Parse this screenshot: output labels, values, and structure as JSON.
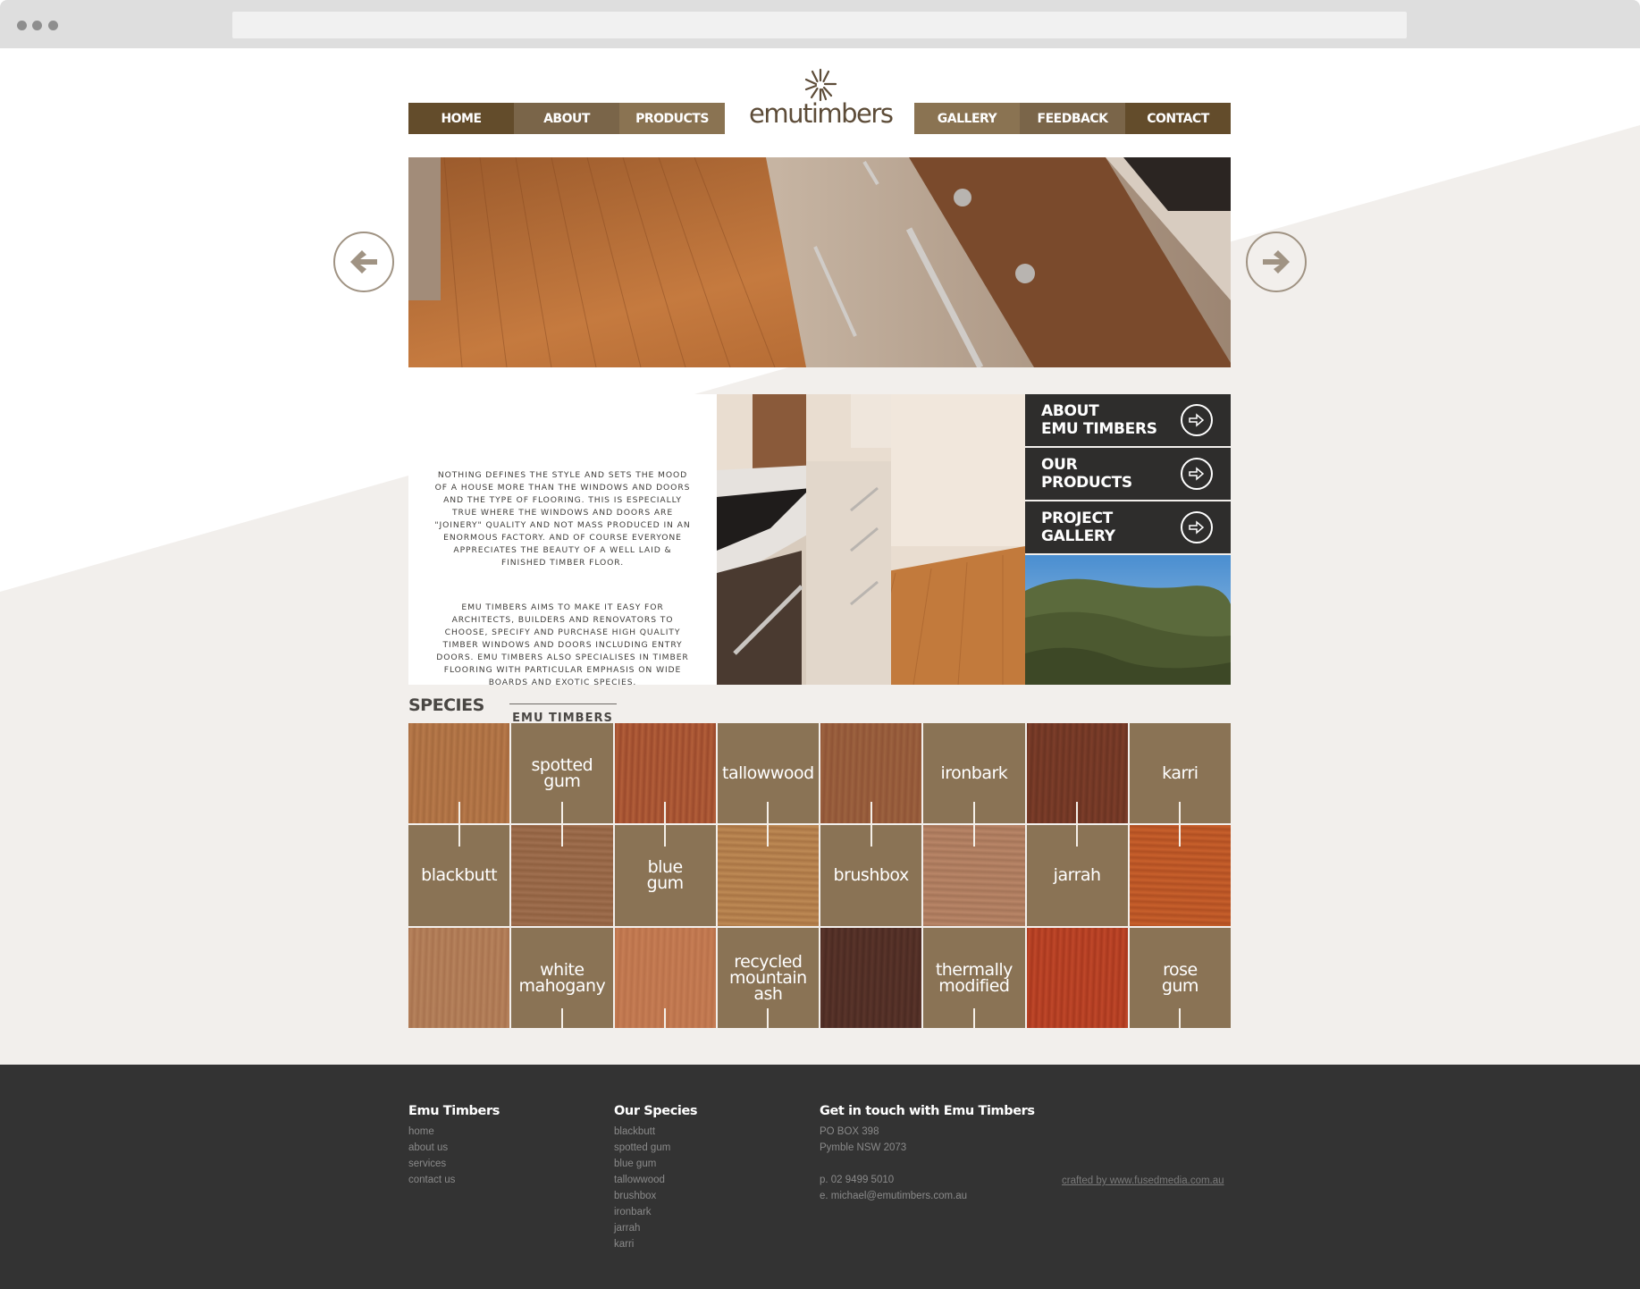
{
  "browser": {
    "window_dots": 3,
    "address": ""
  },
  "brand": {
    "logo_text": "emutimbers",
    "colors": {
      "nav_dark": "#634c2b",
      "nav_mid": "#7a6549",
      "nav_light": "#8a7352",
      "species_tile": "#8a7355",
      "panel_dark": "#2e2d2c",
      "footer_bg": "#333333",
      "page_bg_tint": "#f2efec"
    }
  },
  "nav": {
    "left": [
      {
        "label": "HOME",
        "active": true
      },
      {
        "label": "ABOUT"
      },
      {
        "label": "PRODUCTS"
      }
    ],
    "right": [
      {
        "label": "GALLERY"
      },
      {
        "label": "FEEDBACK"
      },
      {
        "label": "CONTACT"
      }
    ]
  },
  "hero": {
    "image": "kitchen-timber-floor-oven",
    "prev_icon": "arrow-left-icon",
    "next_icon": "arrow-right-icon"
  },
  "intro": {
    "paragraph1": "Nothing defines the style and sets the mood of a house more than the windows and doors and the type of flooring. This is especially true where the windows and doors are \"joinery\" quality and not mass produced in an enormous factory. And of course everyone appreciates the beauty of a well laid & finished timber floor.",
    "paragraph2": "Emu Timbers aims to make it easy for architects, builders and renovators to choose, specify and purchase high quality timber windows and doors including entry doors. Emu Timbers also specialises in timber flooring with particular emphasis on wide boards and exotic species.",
    "signature": "EMU TIMBERS"
  },
  "panel": {
    "links": [
      {
        "label": "ABOUT\nEMU TIMBERS"
      },
      {
        "label": "OUR\nPRODUCTS"
      },
      {
        "label": "PROJECT\nGALLERY"
      }
    ]
  },
  "species": {
    "title": "SPECIES",
    "labels": [
      "spotted\ngum",
      "tallowwood",
      "ironbark",
      "karri",
      "blackbutt",
      "blue\ngum",
      "brushbox",
      "jarrah",
      "white\nmahogany",
      "recycled\nmountain\nash",
      "thermally\nmodified",
      "rose\ngum"
    ]
  },
  "footer": {
    "col1": {
      "title": "Emu Timbers",
      "links": [
        "home",
        "about us",
        "services",
        "contact us"
      ]
    },
    "col2": {
      "title": "Our Species",
      "links": [
        "blackbutt",
        "spotted gum",
        "blue gum",
        "tallowwood",
        "brushbox",
        "ironbark",
        "jarrah",
        "karri"
      ]
    },
    "col3": {
      "title": "Get in touch with Emu Timbers",
      "address1": "PO BOX 398",
      "address2": "Pymble NSW 2073",
      "phone": "p. 02 9499 5010",
      "email": "e. michael@emutimbers.com.au"
    },
    "credit": "crafted by www.fusedmedia.com.au"
  }
}
